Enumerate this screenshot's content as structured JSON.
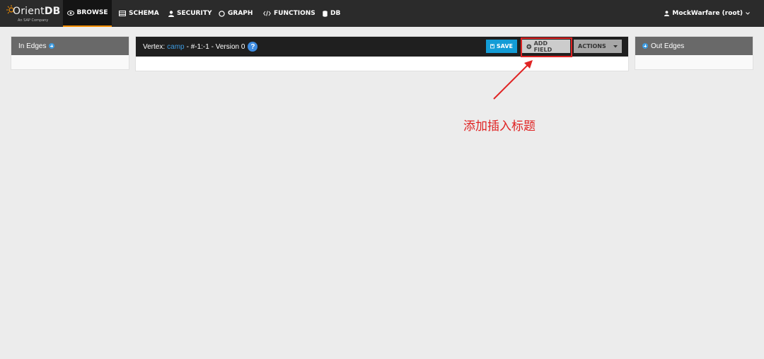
{
  "app": {
    "brand_left": "Orient",
    "brand_right": "DB",
    "brand_sub": "An SAP Company"
  },
  "nav": {
    "items": [
      {
        "label": "BROWSE",
        "icon": "eye-icon",
        "active": true
      },
      {
        "label": "SCHEMA",
        "icon": "table-icon",
        "active": false
      },
      {
        "label": "SECURITY",
        "icon": "user-icon",
        "active": false
      },
      {
        "label": "GRAPH",
        "icon": "circle-icon",
        "active": false
      },
      {
        "label": "FUNCTIONS",
        "icon": "code-icon",
        "active": false
      },
      {
        "label": "DB",
        "icon": "database-icon",
        "active": false
      }
    ],
    "user": "MockWarfare (root)"
  },
  "in_edges": {
    "title": "In Edges"
  },
  "out_edges": {
    "title": "Out Edges"
  },
  "vertex": {
    "prefix": "Vertex:",
    "class_name": "camp",
    "rid_text": "- #-1:-1 - Version 0",
    "help": "?"
  },
  "toolbar": {
    "save_label": "SAVE",
    "add_field_label": "ADD FIELD",
    "actions_label": "ACTIONS"
  },
  "annotation": {
    "text": "添加插入标题",
    "color": "#e02424"
  },
  "colors": {
    "accent": "#f28c00",
    "save": "#139cd6",
    "link": "#3d9be0"
  }
}
